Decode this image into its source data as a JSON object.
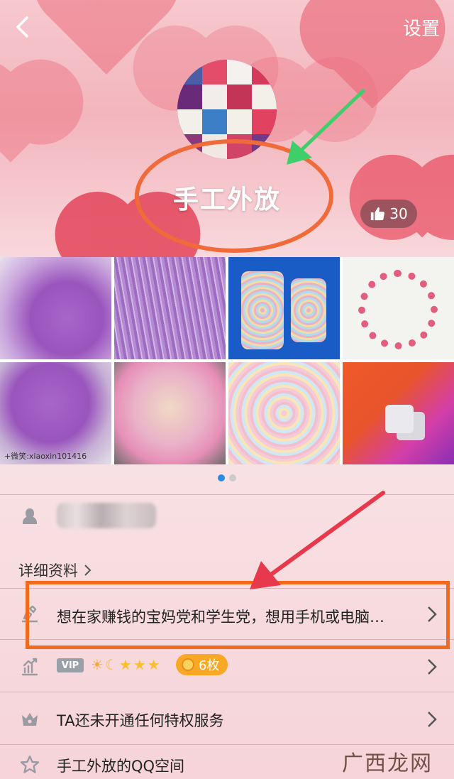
{
  "header": {
    "settings_label": "设置",
    "nickname": "手工外放",
    "likes": "30"
  },
  "photos": {
    "count_visible": 8,
    "pager": {
      "pages": 2,
      "active": 1
    },
    "watermark_text": "+微笑:xiaoxin101416"
  },
  "profile": {
    "detail_label": "详细资料",
    "signature": "想在家赚钱的宝妈党和学生党，想用手机或电脑…",
    "vip_label": "VIP",
    "level_icons": [
      "sun",
      "moon",
      "star",
      "star",
      "star"
    ],
    "coins_label": "6枚",
    "privilege_text": "TA还未开通任何特权服务",
    "qzone_text": "手工外放的QQ空间"
  },
  "branding": {
    "watermark": "广西龙网"
  },
  "colors": {
    "accent_blue": "#2b8be0",
    "highlight_orange": "#f46a1a",
    "arrow_green": "#3fcf6a",
    "arrow_red": "#e8384c"
  }
}
